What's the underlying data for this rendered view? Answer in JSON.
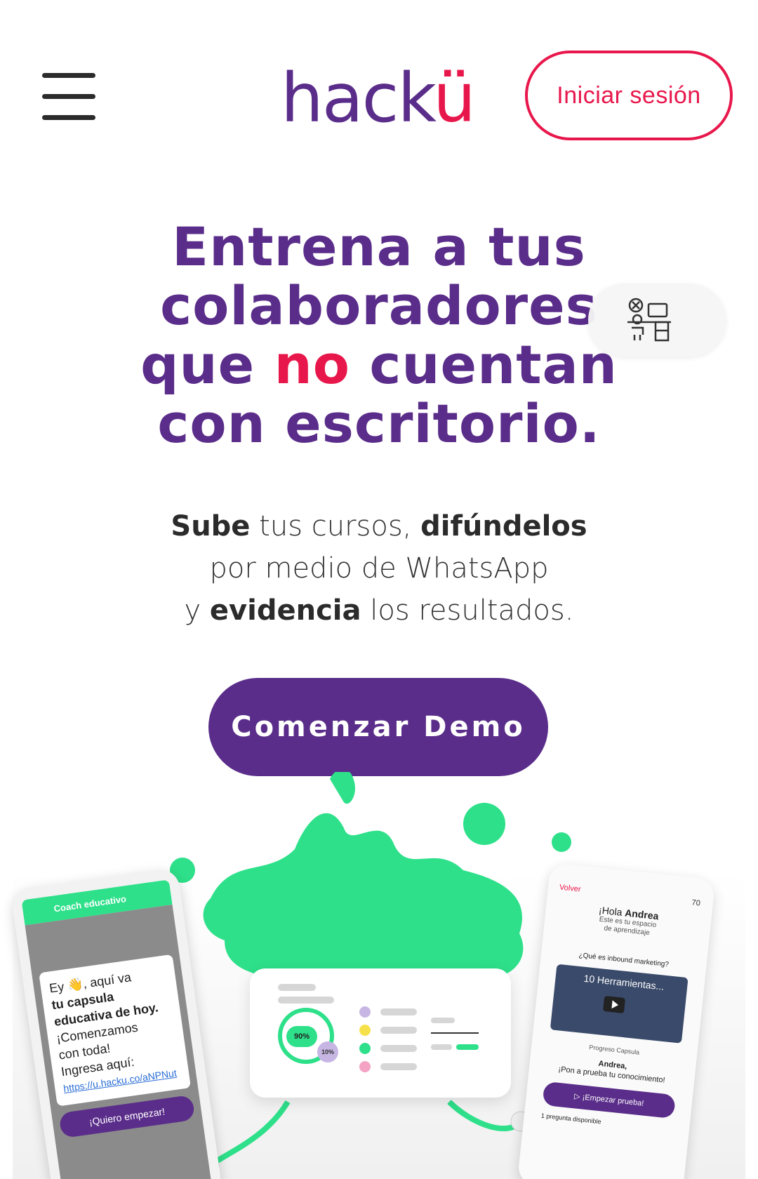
{
  "header": {
    "logo_text": "hack",
    "logo_accent": "ü",
    "login_label": "Iniciar sesión"
  },
  "hero": {
    "title_line1": "Entrena a tus",
    "title_line2": "colaboradores",
    "title_line3_a": "que ",
    "title_line3_accent": "no",
    "title_line3_b": " cuentan",
    "title_line4": "con escritorio.",
    "sub_bold1": "Sube",
    "sub_text1": " tus cursos, ",
    "sub_bold2": "difúndelos",
    "sub_text2": "por medio de WhatsApp",
    "sub_text3": "y ",
    "sub_bold3": "evidencia",
    "sub_text4": " los resultados.",
    "cta_label": "Comenzar Demo",
    "badge_icon": "desk-close-icon"
  },
  "illustration": {
    "left_phone": {
      "header": "Coach educativo",
      "msg1": "Ey 👋, aquí va",
      "msg2": "tu capsula",
      "msg3": "educativa de hoy.",
      "msg4": "¡Comenzamos",
      "msg5": "con toda!",
      "msg6": "Ingresa aquí:",
      "link": "https://u.hacku.co/aNPNut",
      "button": "¡Quiero empezar!"
    },
    "card": {
      "ring_value": "90%",
      "ring_value2": "10%"
    },
    "right_phone": {
      "back": "Volver",
      "score": "70",
      "hello": "¡Hola ",
      "hello_name": "Andrea",
      "space1": "Este es tu espacio",
      "space2": "de aprendizaje",
      "question": "¿Qué es inbound marketing?",
      "video_title": "10 Herramientas...",
      "progress": "Progreso Capsula",
      "name": "Andrea,",
      "challenge": "¡Pon a prueba tu conocimiento!",
      "try_button": "▷ ¡Empezar prueba!",
      "one_question": "1 pregunta disponible"
    }
  },
  "colors": {
    "brand_purple": "#5a2d8a",
    "accent_red": "#e8174b",
    "splash_green": "#2ee08a"
  }
}
